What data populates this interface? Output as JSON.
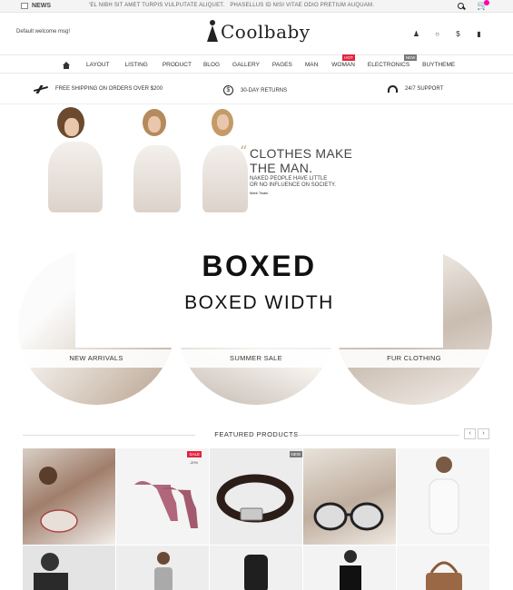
{
  "topbar": {
    "news_label": "NEWS",
    "ticker": [
      "'EL NIBH SIT AMET TURPIS VULPUTATE ALIQUET.",
      "PHASELLUS ID NISI VITAE ODIO PRETIUM AUQUAM."
    ]
  },
  "header": {
    "welcome": "Default welcome msg!",
    "logo_text": "Coolbaby",
    "icons": [
      "user-icon",
      "chat-icon",
      "dollar-icon",
      "chart-icon"
    ]
  },
  "nav": {
    "items": [
      {
        "label": "LAYOUT"
      },
      {
        "label": "LISTING"
      },
      {
        "label": "PRODUCT"
      },
      {
        "label": "BLOG"
      },
      {
        "label": "GALLERY"
      },
      {
        "label": "PAGES"
      },
      {
        "label": "MAN"
      },
      {
        "label": "WOMAN",
        "tag": "HOT"
      },
      {
        "label": "ELECTRONICS",
        "tag": "NEW"
      },
      {
        "label": "BUYTHEME"
      }
    ]
  },
  "services": {
    "shipping": "FREE SHIPPING ON ORDERS OVER $200",
    "returns": "30-DAY RETURNS",
    "support": "24/7 SUPPORT"
  },
  "banner": {
    "quote_line1": "CLOTHES MAKE",
    "quote_line2": "THE MAN.",
    "quote_sub1": "NAKED PEOPLE HAVE LITTLE",
    "quote_sub2": "OR NO INFLUENCE ON SOCIETY.",
    "quote_author": "Mark Twain"
  },
  "overlay": {
    "title": "BOXED",
    "subtitle": "BOXED WIDTH"
  },
  "categories": [
    {
      "label": "NEW ARRIVALS"
    },
    {
      "label": "SUMMER SALE"
    },
    {
      "label": "FUR CLOTHING"
    }
  ],
  "featured": {
    "title": "FEATURED PRODUCTS",
    "prev": "‹",
    "next": "›",
    "badges": {
      "sale": "SALE",
      "discount": "-20%",
      "new": "NEW"
    }
  },
  "colors": {
    "accent_hot": "#e3233e",
    "badge_new": "#777777"
  }
}
